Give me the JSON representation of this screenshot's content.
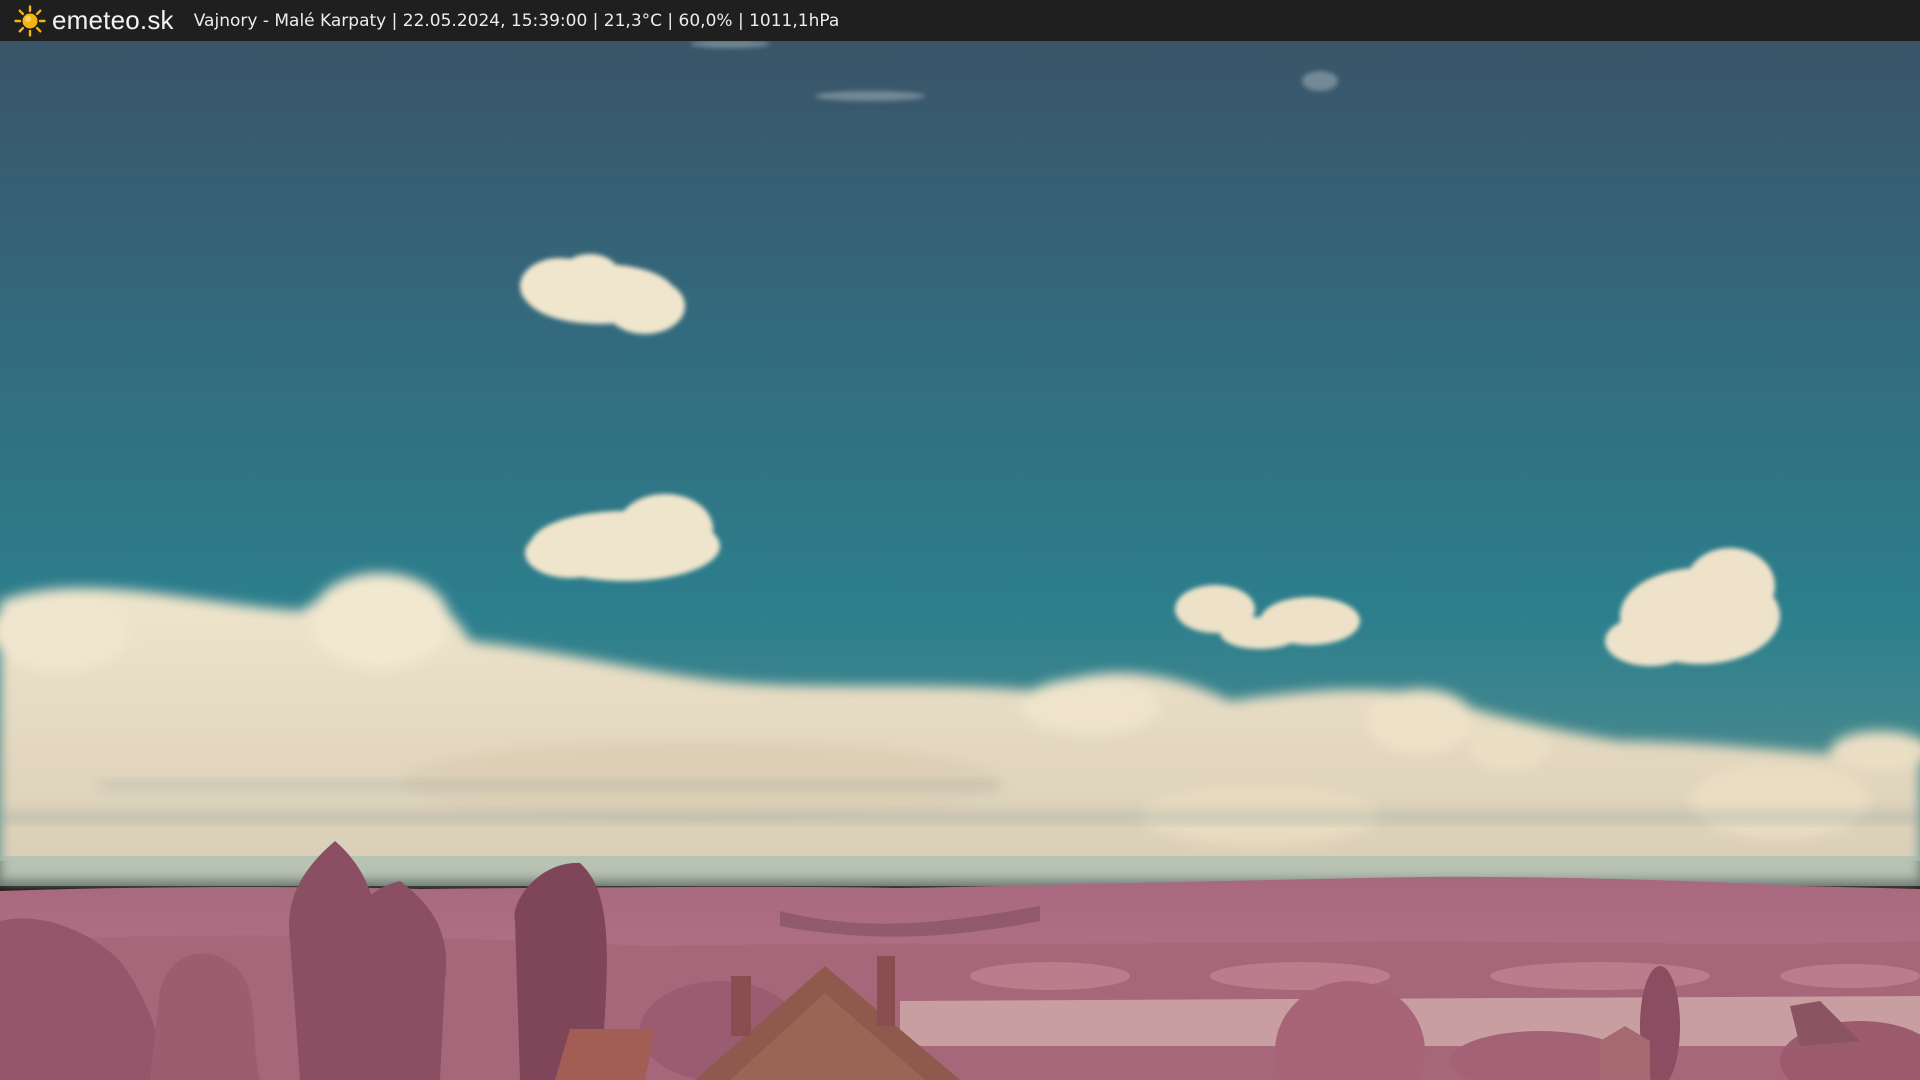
{
  "header": {
    "brand": "emeteo.sk",
    "caption": "Vajnory - Malé Karpaty | 22.05.2024, 15:39:00 | 21,3°C | 60,0% | 1011,1hPa",
    "logo_icon": "sun-icon"
  },
  "colors": {
    "bar_background": "#1f1f1f",
    "sun": "#f4b414",
    "sky_top": "#3d5668",
    "sky_bottom": "#2f7b8c",
    "clouds": "#ece2c9",
    "vegetation": "#b06b80"
  }
}
